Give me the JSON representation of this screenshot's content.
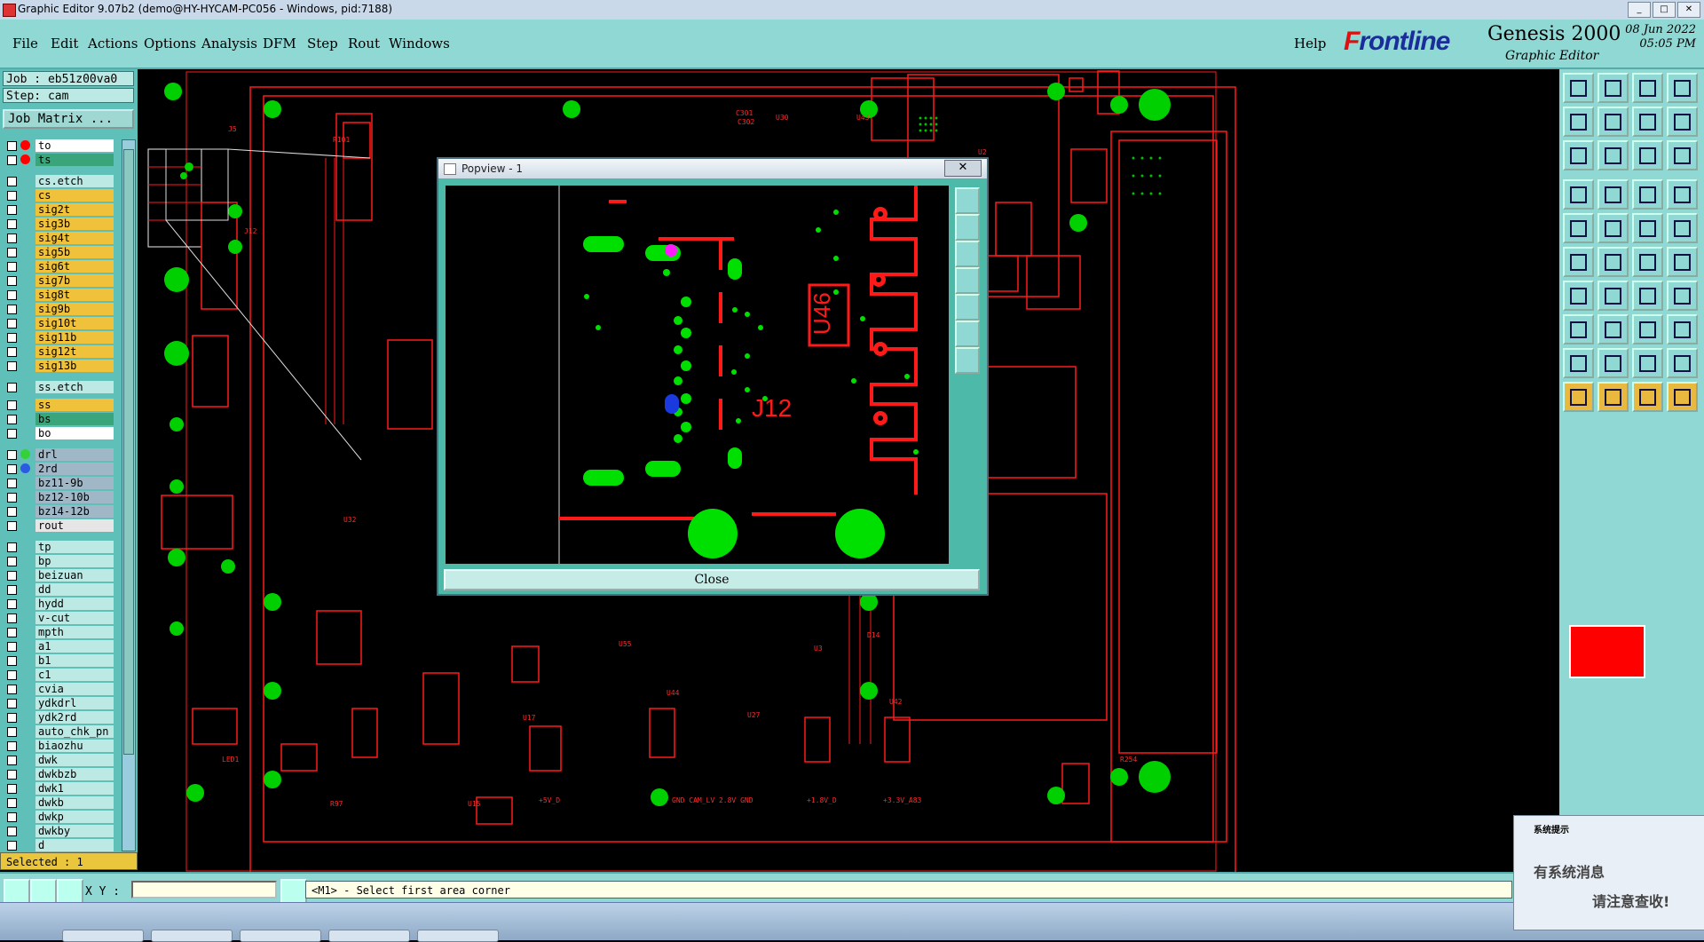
{
  "window": {
    "title": "Graphic Editor 9.07b2 (demo@HY-HYCAM-PC056 - Windows, pid:7188)"
  },
  "menu": {
    "items": [
      "File",
      "Edit",
      "Actions",
      "Options",
      "Analysis",
      "DFM",
      "Step",
      "Rout",
      "Windows"
    ],
    "help": "Help"
  },
  "brand": {
    "logo_mark": "F",
    "logo_rest": "rontline",
    "product": "Genesis 2000",
    "subtitle": "Graphic Editor",
    "date": "08 Jun 2022",
    "time": "05:05 PM"
  },
  "job": {
    "job_label": "Job : eb51z00va0",
    "step_label": "Step: cam",
    "matrix_button": "Job Matrix ..."
  },
  "layers": [
    {
      "name": "to",
      "bg": "#ffffff",
      "dot": "#ff0000"
    },
    {
      "name": "ts",
      "bg": "#3aa57a",
      "dot": "#ff0000"
    },
    {
      "name": "cs.etch",
      "bg": "#bde9e5",
      "dot": ""
    },
    {
      "name": "cs",
      "bg": "#f0c13a",
      "dot": ""
    },
    {
      "name": "sig2t",
      "bg": "#f0c13a",
      "dot": ""
    },
    {
      "name": "sig3b",
      "bg": "#f0c13a",
      "dot": ""
    },
    {
      "name": "sig4t",
      "bg": "#f0c13a",
      "dot": ""
    },
    {
      "name": "sig5b",
      "bg": "#f0c13a",
      "dot": ""
    },
    {
      "name": "sig6t",
      "bg": "#f0c13a",
      "dot": ""
    },
    {
      "name": "sig7b",
      "bg": "#f0c13a",
      "dot": ""
    },
    {
      "name": "sig8t",
      "bg": "#f0c13a",
      "dot": ""
    },
    {
      "name": "sig9b",
      "bg": "#f0c13a",
      "dot": ""
    },
    {
      "name": "sig10t",
      "bg": "#f0c13a",
      "dot": ""
    },
    {
      "name": "sig11b",
      "bg": "#f0c13a",
      "dot": ""
    },
    {
      "name": "sig12t",
      "bg": "#f0c13a",
      "dot": ""
    },
    {
      "name": "sig13b",
      "bg": "#f0c13a",
      "dot": ""
    },
    {
      "name": "ss.etch",
      "bg": "#bde9e5",
      "dot": ""
    },
    {
      "name": "ss",
      "bg": "#f0c13a",
      "dot": ""
    },
    {
      "name": "bs",
      "bg": "#3aa57a",
      "dot": ""
    },
    {
      "name": "bo",
      "bg": "#ffffff",
      "dot": ""
    },
    {
      "name": "drl",
      "bg": "#9fb7c7",
      "dot": "#36d13a"
    },
    {
      "name": "2rd",
      "bg": "#9fb7c7",
      "dot": "#2a5be0"
    },
    {
      "name": "bz11-9b",
      "bg": "#9fb7c7",
      "dot": ""
    },
    {
      "name": "bz12-10b",
      "bg": "#9fb7c7",
      "dot": ""
    },
    {
      "name": "bz14-12b",
      "bg": "#9fb7c7",
      "dot": ""
    },
    {
      "name": "rout",
      "bg": "#e6e6e6",
      "dot": ""
    },
    {
      "name": "tp",
      "bg": "#bde9e5",
      "dot": ""
    },
    {
      "name": "bp",
      "bg": "#bde9e5",
      "dot": ""
    },
    {
      "name": "beizuan",
      "bg": "#bde9e5",
      "dot": ""
    },
    {
      "name": "dd",
      "bg": "#bde9e5",
      "dot": ""
    },
    {
      "name": "hydd",
      "bg": "#bde9e5",
      "dot": ""
    },
    {
      "name": "v-cut",
      "bg": "#bde9e5",
      "dot": ""
    },
    {
      "name": "mpth",
      "bg": "#bde9e5",
      "dot": ""
    },
    {
      "name": "a1",
      "bg": "#bde9e5",
      "dot": ""
    },
    {
      "name": "b1",
      "bg": "#bde9e5",
      "dot": ""
    },
    {
      "name": "c1",
      "bg": "#bde9e5",
      "dot": ""
    },
    {
      "name": "cvia",
      "bg": "#bde9e5",
      "dot": ""
    },
    {
      "name": "ydkdrl",
      "bg": "#bde9e5",
      "dot": ""
    },
    {
      "name": "ydk2rd",
      "bg": "#bde9e5",
      "dot": ""
    },
    {
      "name": "auto_chk_pn",
      "bg": "#bde9e5",
      "dot": ""
    },
    {
      "name": "biaozhu",
      "bg": "#bde9e5",
      "dot": ""
    },
    {
      "name": "dwk",
      "bg": "#bde9e5",
      "dot": ""
    },
    {
      "name": "dwkbzb",
      "bg": "#bde9e5",
      "dot": ""
    },
    {
      "name": "dwk1",
      "bg": "#bde9e5",
      "dot": ""
    },
    {
      "name": "dwkb",
      "bg": "#bde9e5",
      "dot": ""
    },
    {
      "name": "dwkp",
      "bg": "#bde9e5",
      "dot": ""
    },
    {
      "name": "dwkby",
      "bg": "#bde9e5",
      "dot": ""
    },
    {
      "name": "d",
      "bg": "#bde9e5",
      "dot": ""
    }
  ],
  "selected": "Selected : 1",
  "popview": {
    "title": "Popview - 1",
    "close_label": "Close",
    "close_x": "✕",
    "label_u46": "U46",
    "label_j12": "J12"
  },
  "status": {
    "xy_label": "X Y :",
    "xy_value": "",
    "message": "<M1> - Select first area corner"
  },
  "sysmsg": {
    "header": "系统提示",
    "line1": "有系统消息",
    "line2": "请注意查收!"
  },
  "pcb_labels": [
    "J5",
    "J12",
    "R101",
    "C301",
    "C302",
    "U30",
    "U41",
    "U43",
    "R223",
    "R241",
    "C261",
    "U55",
    "U44",
    "U10",
    "U3",
    "U42",
    "U17",
    "U27",
    "D14",
    "D1",
    "R272",
    "R138",
    "R97",
    "U15",
    "LED1",
    "R269",
    "U1",
    "U2",
    "U32",
    "R254",
    "J7",
    "J6",
    "Q1",
    "R128",
    "R126",
    "R129",
    "+3.3V_A83",
    "+1.8V_D",
    "GND CAM_LV 2.8V GND",
    "+5V_D",
    "R23",
    "R241"
  ],
  "colors": {
    "panel": "#8fd8d4",
    "trace": "#ff0000",
    "pad": "#00e000",
    "signal": "#f0c13a"
  }
}
